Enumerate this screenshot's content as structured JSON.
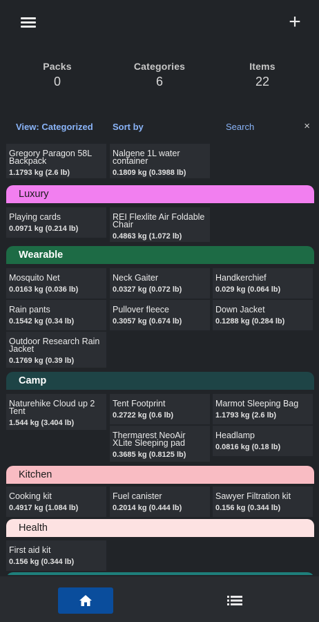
{
  "header": {
    "menu_icon": "hamburger-icon",
    "add_label": "+"
  },
  "stats": [
    {
      "label": "Packs",
      "value": "0"
    },
    {
      "label": "Categories",
      "value": "6"
    },
    {
      "label": "Items",
      "value": "22"
    }
  ],
  "controls": {
    "view_label": "View: Categorized",
    "sort_label": "Sort by",
    "search_placeholder": "Search",
    "clear_label": "×"
  },
  "uncategorized": [
    {
      "name": "Gregory Paragon 58L Backpack",
      "weight": "1.1793 kg (2.6 lb)"
    },
    {
      "name": "Nalgene 1L water container",
      "weight": "0.1809 kg (0.3988 lb)"
    }
  ],
  "categories": [
    {
      "name": "Luxury",
      "color": "#f27ff0",
      "items": [
        {
          "name": "Playing cards",
          "weight": "0.0971 kg (0.214 lb)"
        },
        {
          "name": "REI Flexlite Air Foldable Chair",
          "weight": "0.4863 kg (1.072 lb)"
        }
      ]
    },
    {
      "name": "Wearable",
      "color": "#1d6b45",
      "items": [
        {
          "name": "Mosquito Net",
          "weight": "0.0163 kg (0.036 lb)"
        },
        {
          "name": "Neck Gaiter",
          "weight": "0.0327 kg (0.072 lb)"
        },
        {
          "name": "Handkerchief",
          "weight": "0.029 kg (0.064 lb)"
        },
        {
          "name": "Rain pants",
          "weight": "0.1542 kg (0.34 lb)"
        },
        {
          "name": "Pullover fleece",
          "weight": "0.3057 kg (0.674 lb)"
        },
        {
          "name": "Down Jacket",
          "weight": "0.1288 kg (0.284 lb)"
        },
        {
          "name": "Outdoor Research Rain Jacket",
          "weight": "0.1769 kg (0.39 lb)"
        }
      ]
    },
    {
      "name": "Camp",
      "color": "#1e4446",
      "items": [
        {
          "name": "Naturehike Cloud up 2 Tent",
          "weight": "1.544 kg (3.404 lb)"
        },
        {
          "name": "Tent Footprint",
          "weight": "0.2722 kg (0.6 lb)"
        },
        {
          "name": "Marmot Sleeping Bag",
          "weight": "1.1793 kg (2.6 lb)"
        },
        {
          "name": "Thermarest NeoAir XLite Sleeping pad",
          "weight": "0.3685 kg (0.8125 lb)"
        },
        {
          "name": "Headlamp",
          "weight": "0.0816 kg (0.18 lb)"
        }
      ]
    },
    {
      "name": "Kitchen",
      "color": "#f9bcc3",
      "items": [
        {
          "name": "Cooking kit",
          "weight": "0.4917 kg (1.084 lb)"
        },
        {
          "name": "Fuel canister",
          "weight": "0.2014 kg (0.444 lb)"
        },
        {
          "name": "Sawyer Filtration kit",
          "weight": "0.156 kg (0.344 lb)"
        }
      ]
    },
    {
      "name": "Health",
      "color": "#fde2e2",
      "items": [
        {
          "name": "First aid kit",
          "weight": "0.156 kg (0.344 lb)"
        }
      ]
    }
  ],
  "bottom_nav": {
    "home_icon": "home-icon",
    "list_icon": "list-icon",
    "active_color": "#0a4d9c"
  }
}
